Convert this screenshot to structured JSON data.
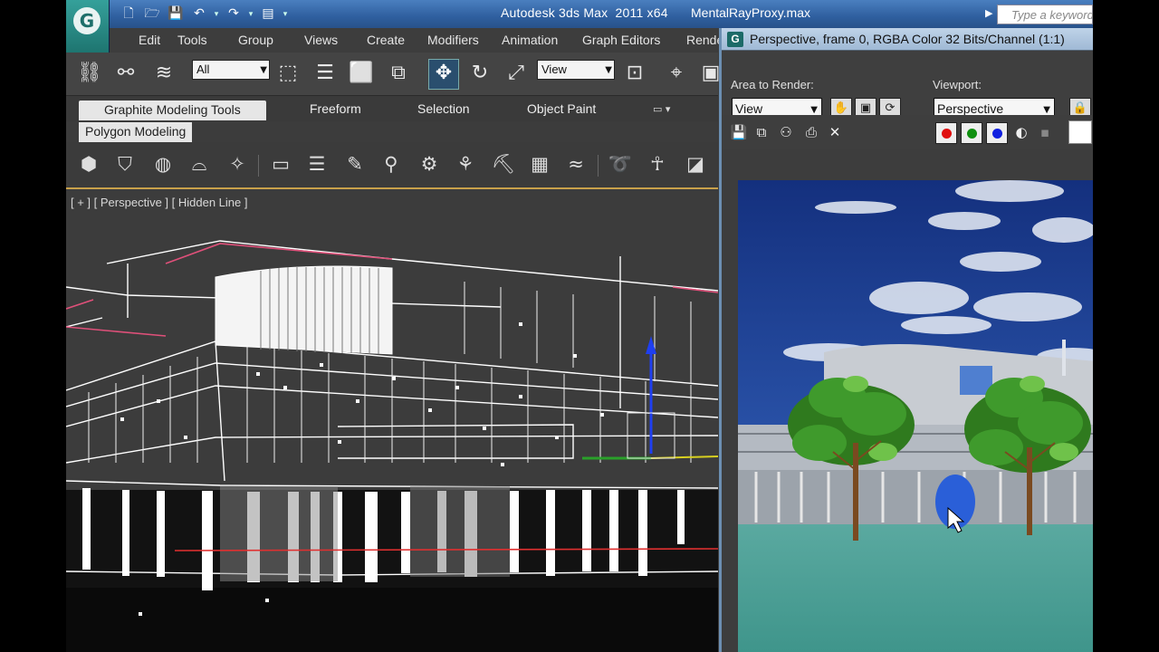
{
  "window": {
    "app_title": "Autodesk 3ds Max  2011 x64",
    "file_name": "MentalRayProxy.max",
    "search_placeholder": "Type a keyword"
  },
  "menu": [
    "Edit",
    "Tools",
    "Group",
    "Views",
    "Create",
    "Modifiers",
    "Animation",
    "Graph Editors",
    "Rendering"
  ],
  "toolbar": {
    "selection_filter": "All",
    "reference_coord": "View"
  },
  "ribbon": {
    "tabs": [
      "Graphite Modeling Tools",
      "Freeform",
      "Selection",
      "Object Paint"
    ],
    "options_glyph": "▭ ▾",
    "panel_label": "Polygon Modeling"
  },
  "viewport": {
    "label": "[ + ] [ Perspective ] [ Hidden Line ]"
  },
  "render_window": {
    "title": "Perspective, frame 0, RGBA Color 32 Bits/Channel (1:1)",
    "area_to_render_label": "Area to Render:",
    "area_to_render_value": "View",
    "viewport_label": "Viewport:",
    "viewport_value": "Perspective"
  },
  "colors": {
    "title_bar": "#3a6cad",
    "ui_dark": "#3c3c3c",
    "accent": "#c8a14a",
    "wire": "#ffffff",
    "wire_highlight": "#e0507a",
    "gizmo_blue": "#1f3ff0",
    "sky": "#1c3f9a",
    "water": "#4fa59b"
  }
}
